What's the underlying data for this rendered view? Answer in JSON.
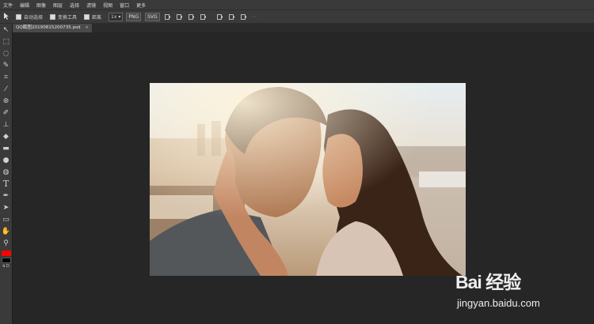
{
  "menu": [
    "文件",
    "编辑",
    "图像",
    "图层",
    "选择",
    "滤镜",
    "视图",
    "窗口",
    "更多"
  ],
  "options": {
    "auto_select": "自动选择",
    "transform": "变换工具",
    "distance": "距离",
    "zoom_select": "1x",
    "png_label": "PNG",
    "svg_label": "SVG"
  },
  "tab": {
    "filename": "QQ截图20190815200735.psd",
    "close": "×"
  },
  "toolbar": {
    "icons": [
      "arrow-icon",
      "marquee-icon",
      "lasso-icon",
      "magic-wand-icon",
      "crop-icon",
      "eyedropper-icon",
      "healing-icon",
      "brush-icon",
      "stamp-icon",
      "eraser-icon",
      "gradient-icon",
      "blur-icon",
      "dodge-icon",
      "type-icon",
      "pen-icon",
      "path-select-icon",
      "rectangle-icon",
      "hand-icon",
      "zoom-icon"
    ],
    "foreground_color": "#ff0000",
    "background_color": "#000000",
    "swap_label": "ā D"
  },
  "watermark": {
    "brand": "Bai 经验",
    "url": "jingyan.baidu.com"
  }
}
